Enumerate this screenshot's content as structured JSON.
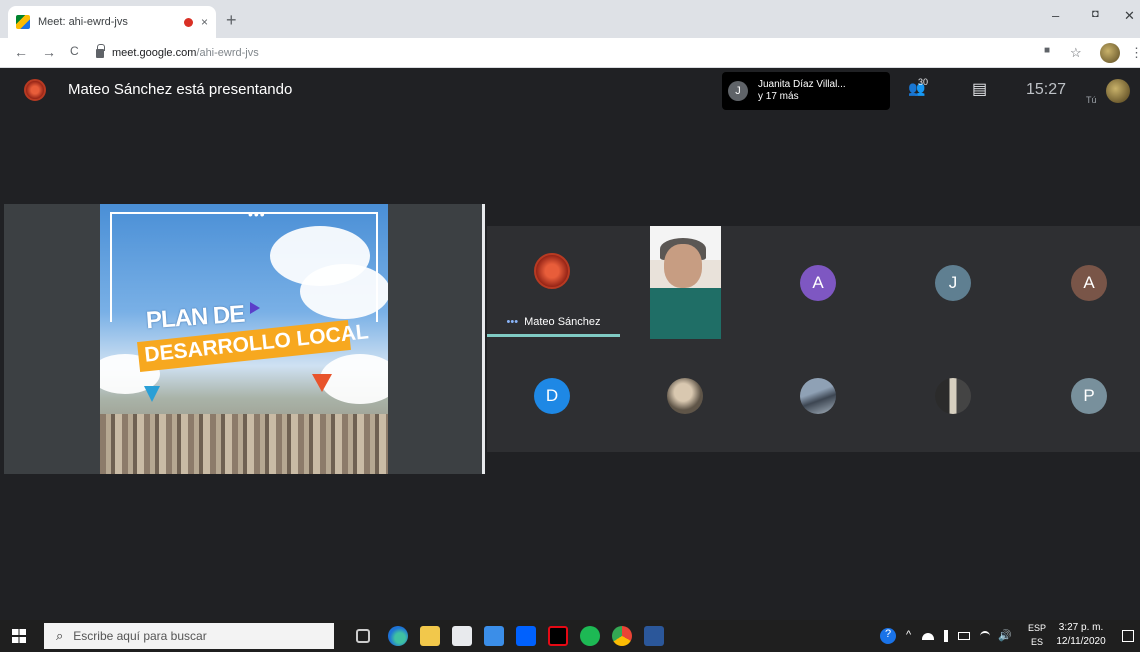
{
  "browser": {
    "tab_title": "Meet: ahi-ewrd-jvs",
    "tab_close": "×",
    "new_tab": "+",
    "url_host": "meet.google.com",
    "url_path": "/ahi-ewrd-jvs",
    "back": "←",
    "forward": "→",
    "reload": "C",
    "minimize": "–",
    "maximize": "◘",
    "close": "✕",
    "extension_icon": "■",
    "star": "☆",
    "menu": "⋮"
  },
  "meet": {
    "presenter_text": "Mateo Sánchez está presentando",
    "people_chip": "J",
    "people_line1": "Juanita Díaz Villal...",
    "people_line2": "y 17 más",
    "participants_count": "30",
    "participants_icon": "👥",
    "chat_icon": "▤",
    "time": "15:27",
    "you_label": "Tú",
    "slide": {
      "dots": "•••",
      "line1": "PLAN DE",
      "line2_a": "DESARROLLO ",
      "line2_b": "LOCAL"
    },
    "tiles": [
      {
        "name": "Mateo Sánchez",
        "dots": "•••"
      },
      {
        "letter": "A",
        "color": "#7e57c2"
      },
      {
        "letter": "J",
        "color": "#5f7f91"
      },
      {
        "letter": "A",
        "color": "#795548"
      },
      {
        "letter": "D",
        "color": "#1e88e5"
      },
      {
        "letter": "P",
        "color": "#78909c"
      }
    ]
  },
  "taskbar": {
    "search_placeholder": "Escribe aquí para buscar",
    "search_glyph": "⌕",
    "lang_top": "ESP",
    "lang_bottom": "ES",
    "time": "3:27 p. m.",
    "date": "12/11/2020",
    "tray_help": "?",
    "tray_chevron": "^",
    "tray_volume": "🔊"
  }
}
